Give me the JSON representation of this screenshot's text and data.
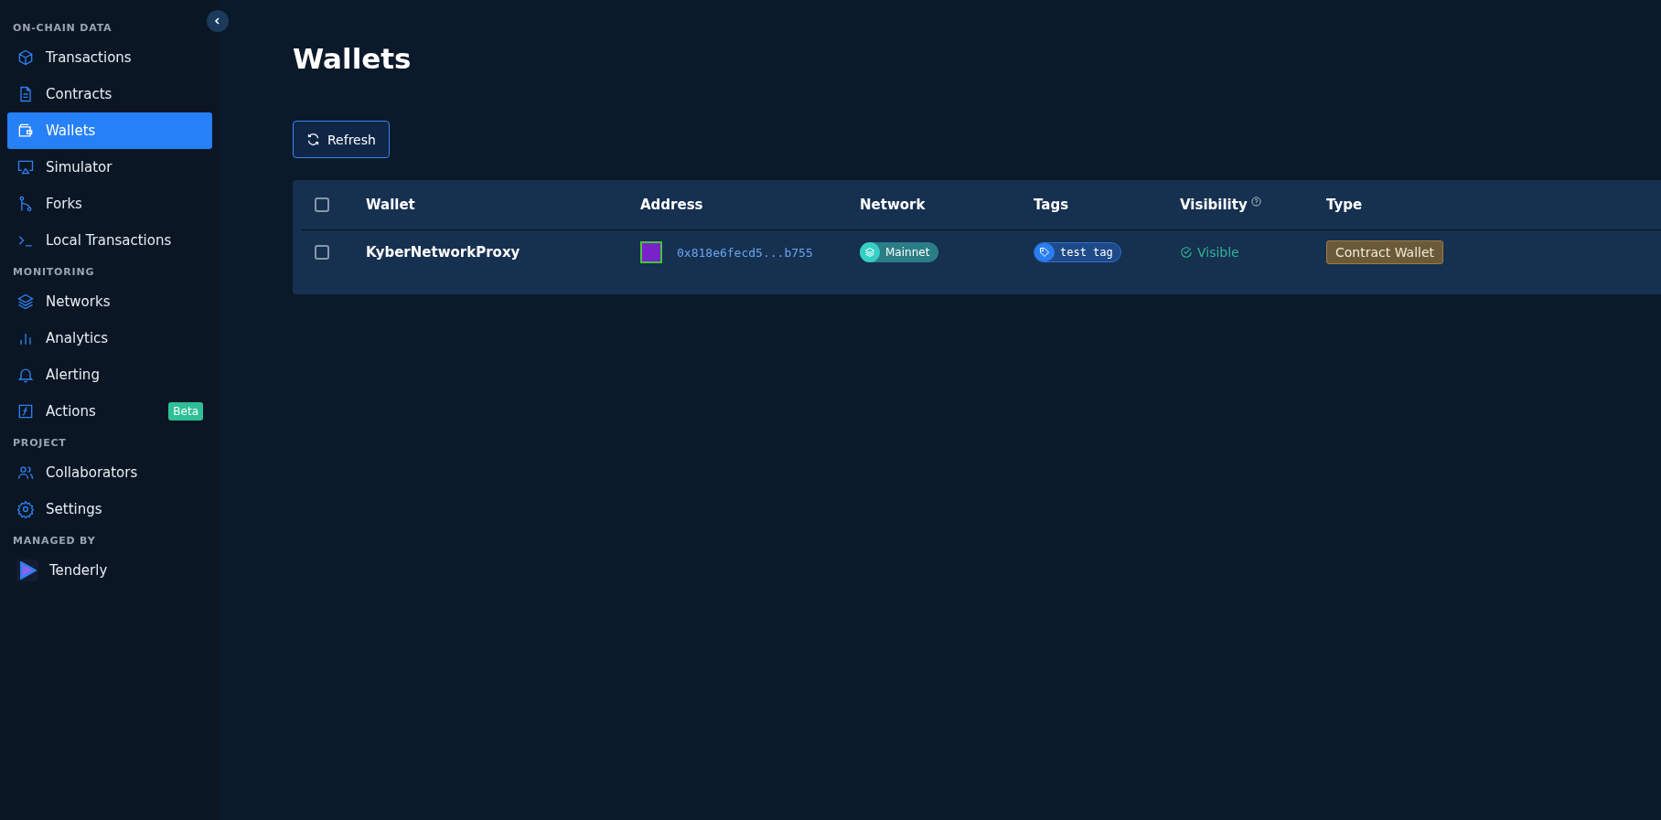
{
  "sidebar": {
    "sections": [
      {
        "heading": "ON-CHAIN DATA",
        "items": [
          {
            "label": "Transactions",
            "selected": false
          },
          {
            "label": "Contracts",
            "selected": false
          },
          {
            "label": "Wallets",
            "selected": true
          },
          {
            "label": "Simulator",
            "selected": false
          },
          {
            "label": "Forks",
            "selected": false
          },
          {
            "label": "Local Transactions",
            "selected": false
          }
        ]
      },
      {
        "heading": "MONITORING",
        "items": [
          {
            "label": "Networks",
            "selected": false
          },
          {
            "label": "Analytics",
            "selected": false
          },
          {
            "label": "Alerting",
            "selected": false
          },
          {
            "label": "Actions",
            "selected": false,
            "badge": "Beta"
          }
        ]
      },
      {
        "heading": "PROJECT",
        "items": [
          {
            "label": "Collaborators",
            "selected": false
          },
          {
            "label": "Settings",
            "selected": false
          }
        ]
      },
      {
        "heading": "MANAGED BY",
        "items": [
          {
            "label": "Tenderly",
            "selected": false
          }
        ]
      }
    ]
  },
  "page": {
    "title": "Wallets",
    "refresh_button": "Refresh"
  },
  "table": {
    "columns": [
      "Wallet",
      "Address",
      "Network",
      "Tags",
      "Visibility",
      "Type"
    ],
    "rows": [
      {
        "checked": false,
        "wallet": "KyberNetworkProxy",
        "address": "0x818e6fecd5...b755",
        "network": "Mainnet",
        "tag": "test tag",
        "visibility": "Visible",
        "type": "Contract Wallet"
      }
    ],
    "all_checked": false
  }
}
